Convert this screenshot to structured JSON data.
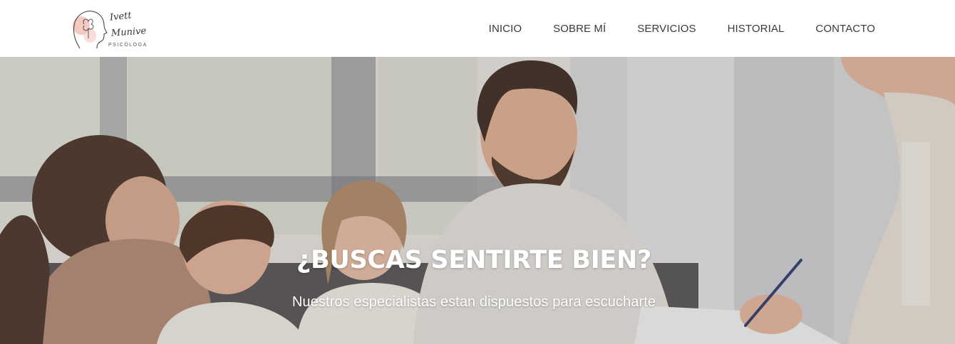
{
  "header": {
    "logo": {
      "name_line1": "Ivett",
      "name_line2": "Munive",
      "subtitle": "PSICÓLOGA",
      "accent_color": "#f2b8b0"
    },
    "nav": [
      {
        "label": "INICIO"
      },
      {
        "label": "SOBRE MÍ"
      },
      {
        "label": "SERVICIOS"
      },
      {
        "label": "HISTORIAL"
      },
      {
        "label": "CONTACTO"
      }
    ]
  },
  "hero": {
    "title": "¿BUSCAS SENTIRTE BIEN?",
    "subtitle": "Nuestros especialistas estan dispuestos para escucharte",
    "image_alt": "family-therapy-session-photo"
  }
}
